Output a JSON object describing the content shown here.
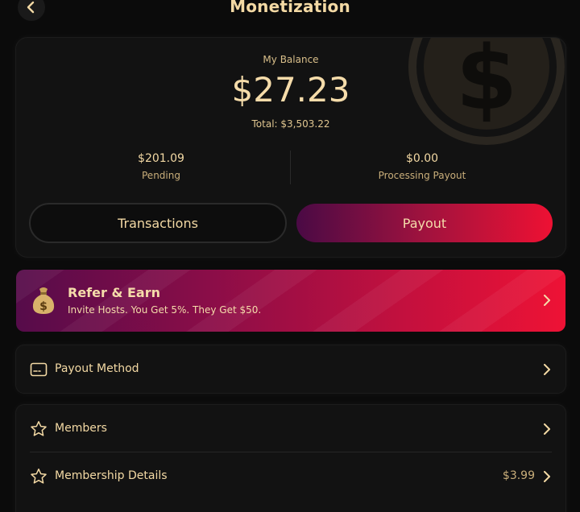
{
  "header": {
    "title": "Monetization",
    "back_icon": "chevron-left-icon"
  },
  "balance": {
    "label": "My Balance",
    "amount": "$27.23",
    "total": "Total: $3,503.22",
    "pending_value": "$201.09",
    "pending_label": "Pending",
    "processing_value": "$0.00",
    "processing_label": "Processing Payout",
    "transactions_label": "Transactions",
    "payout_label": "Payout"
  },
  "refer": {
    "title": "Refer & Earn",
    "subtitle": "Invite Hosts. You Get 5%. They Get $50.",
    "icon": "money-bag-icon"
  },
  "menu": {
    "payout_method": {
      "label": "Payout Method",
      "icon": "card-icon"
    },
    "members": {
      "label": "Members",
      "icon": "star-icon"
    },
    "membership_details": {
      "label": "Membership Details",
      "value": "$3.99",
      "icon": "star-icon"
    }
  },
  "colors": {
    "background": "#0b0b0b",
    "card": "#121212",
    "gold_text": "#f3d9a4",
    "accent_red": "#ee1133",
    "accent_purple": "#4a0a45"
  }
}
